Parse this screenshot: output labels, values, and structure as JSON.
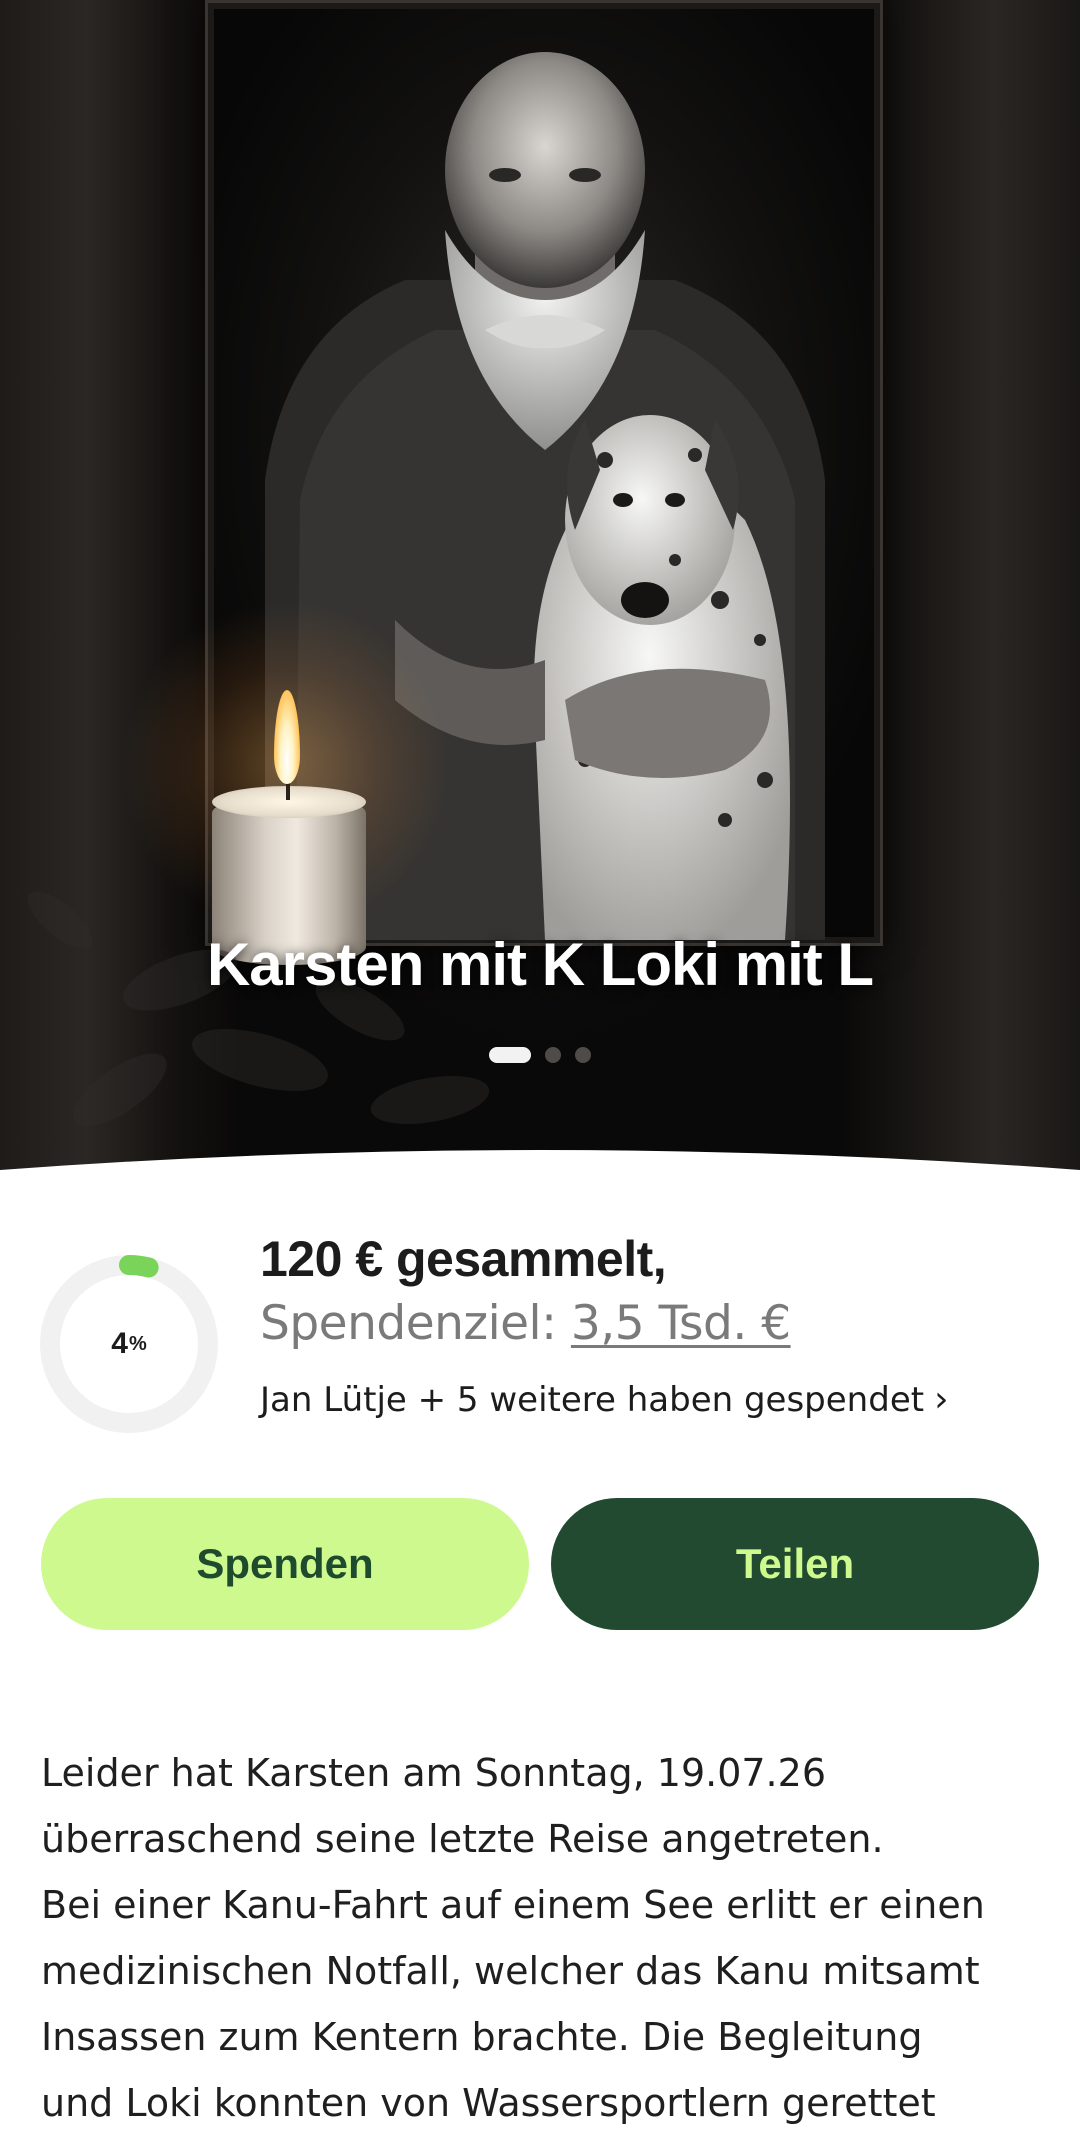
{
  "hero": {
    "title": "Karsten mit K Loki mit L",
    "slides_total": 3,
    "active_slide": 1
  },
  "summary": {
    "percent_value": 4,
    "percent_sign": "%",
    "amount_label": "120 € gesammelt,",
    "goal_prefix": "Spendenziel: ",
    "goal_value": "3,5 Tsd. €",
    "donors_text": "Jan Lütje + 5 weitere haben gespendet"
  },
  "actions": {
    "donate_label": "Spenden",
    "share_label": "Teilen"
  },
  "story": {
    "text": "Leider hat Karsten am Sonntag, 19.07.26\nüberraschend seine letzte Reise angetreten.\nBei einer Kanu-Fahrt auf einem See erlitt er einen\nmedizinischen Notfall, welcher das Kanu mitsamt\nInsassen zum Kentern brachte. Die Begleitung\nund Loki konnten von Wassersportlern gerettet"
  },
  "colors": {
    "accent_light": "#cdf98f",
    "accent_dark": "#224a30",
    "progress": "#7ad45a",
    "track": "#f1f1f1"
  }
}
